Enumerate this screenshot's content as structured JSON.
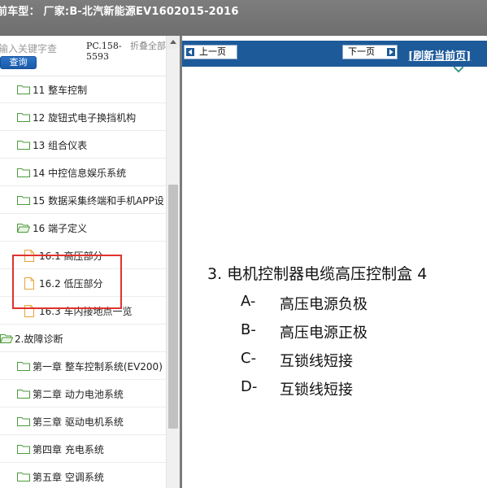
{
  "titlebar": {
    "text": "前车型：  厂家:B-北汽新能源EV1602015-2016"
  },
  "sidebar": {
    "search_placeholder": "输入关键字查",
    "search_button": "查询",
    "pc_code": "PC.158-5593",
    "collapse_all": "折叠全部",
    "tree": [
      {
        "label": "11 整车控制",
        "icon": "folder-icon",
        "level": 1
      },
      {
        "label": "12 旋钮式电子换挡机构",
        "icon": "folder-icon",
        "level": 1
      },
      {
        "label": "13 组合仪表",
        "icon": "folder-icon",
        "level": 1
      },
      {
        "label": "14 中控信息娱乐系统",
        "icon": "folder-icon",
        "level": 1
      },
      {
        "label": "15 数据采集终端和手机APP设",
        "icon": "folder-icon",
        "level": 1
      },
      {
        "label": "16 端子定义",
        "icon": "folder-open-icon",
        "level": 1
      },
      {
        "label": "16.1 高压部分",
        "icon": "document-icon",
        "level": 2
      },
      {
        "label": "16.2 低压部分",
        "icon": "document-icon",
        "level": 2
      },
      {
        "label": "16.3 车内接地点一览",
        "icon": "document-icon",
        "level": 2
      },
      {
        "label": "2.故障诊断",
        "icon": "folder-open-icon",
        "level": 0
      },
      {
        "label": "第一章 整车控制系统(EV200)",
        "icon": "folder-icon",
        "level": 1
      },
      {
        "label": "第二章 动力电池系统",
        "icon": "folder-icon",
        "level": 1
      },
      {
        "label": "第三章 驱动电机系统",
        "icon": "folder-icon",
        "level": 1
      },
      {
        "label": "第四章 充电系统",
        "icon": "folder-icon",
        "level": 1
      },
      {
        "label": "第五章 空调系统",
        "icon": "folder-icon",
        "level": 1
      }
    ]
  },
  "nav": {
    "prev": "上一页",
    "next": "下一页",
    "refresh": "[刷新当前页]"
  },
  "document": {
    "heading": "3.    电机控制器电缆高压控制盒 4",
    "items": [
      {
        "letter": "A-",
        "text": "高压电源负极"
      },
      {
        "letter": "B-",
        "text": "高压电源正极"
      },
      {
        "letter": "C-",
        "text": "互锁线短接"
      },
      {
        "letter": "D-",
        "text": "互锁线短接"
      }
    ]
  },
  "colors": {
    "titlebar": "#737373",
    "nav_bar": "#1d5a99",
    "highlight": "#e0322d",
    "folder": "#4a9a3a",
    "document_icon": "#e8a23a"
  }
}
